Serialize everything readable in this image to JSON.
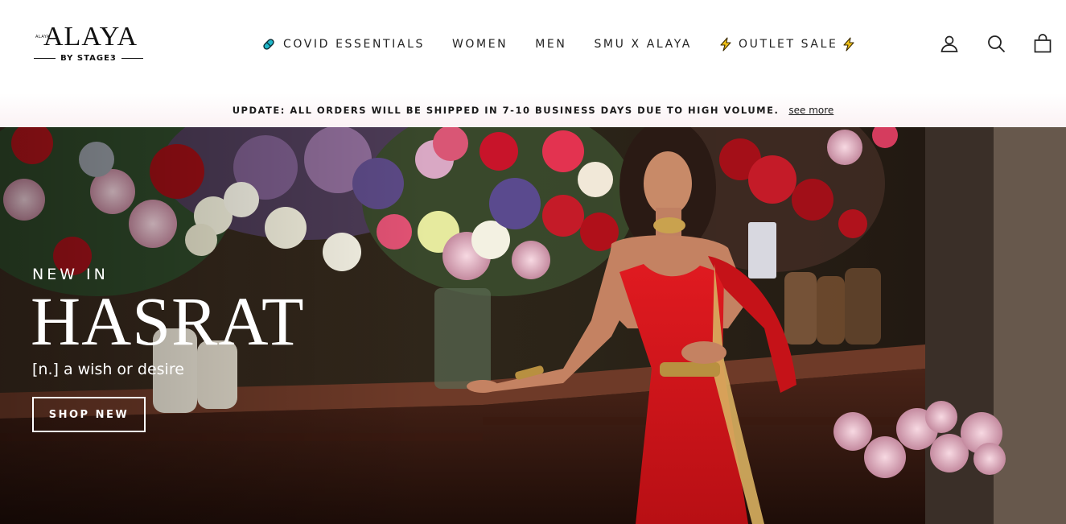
{
  "brand": {
    "small_text": "ALAYA",
    "name": "ALAYA",
    "tagline": "BY STAGE3"
  },
  "nav": {
    "items": [
      {
        "label": "COVID ESSENTIALS",
        "icon": "pill-icon"
      },
      {
        "label": "WOMEN"
      },
      {
        "label": "MEN"
      },
      {
        "label": "SMU X ALAYA"
      },
      {
        "label": "OUTLET SALE",
        "icon": "lightning-bolt-icon"
      }
    ]
  },
  "header_icons": [
    "account-icon",
    "search-icon",
    "shopping-bag-icon"
  ],
  "announcement": {
    "text": "UPDATE: ALL ORDERS WILL BE SHIPPED IN 7-10 BUSINESS DAYS DUE TO HIGH VOLUME.",
    "link": "see more"
  },
  "hero": {
    "eyebrow": "NEW IN",
    "title": "HASRAT",
    "subtitle": "[n.] a wish or desire",
    "button": "SHOP NEW"
  },
  "colors": {
    "accent_teal": "#1fb7c9",
    "bolt_yellow": "#f2c318",
    "announce_bg": "#fbf2f4",
    "dress_red": "#d4161c"
  }
}
